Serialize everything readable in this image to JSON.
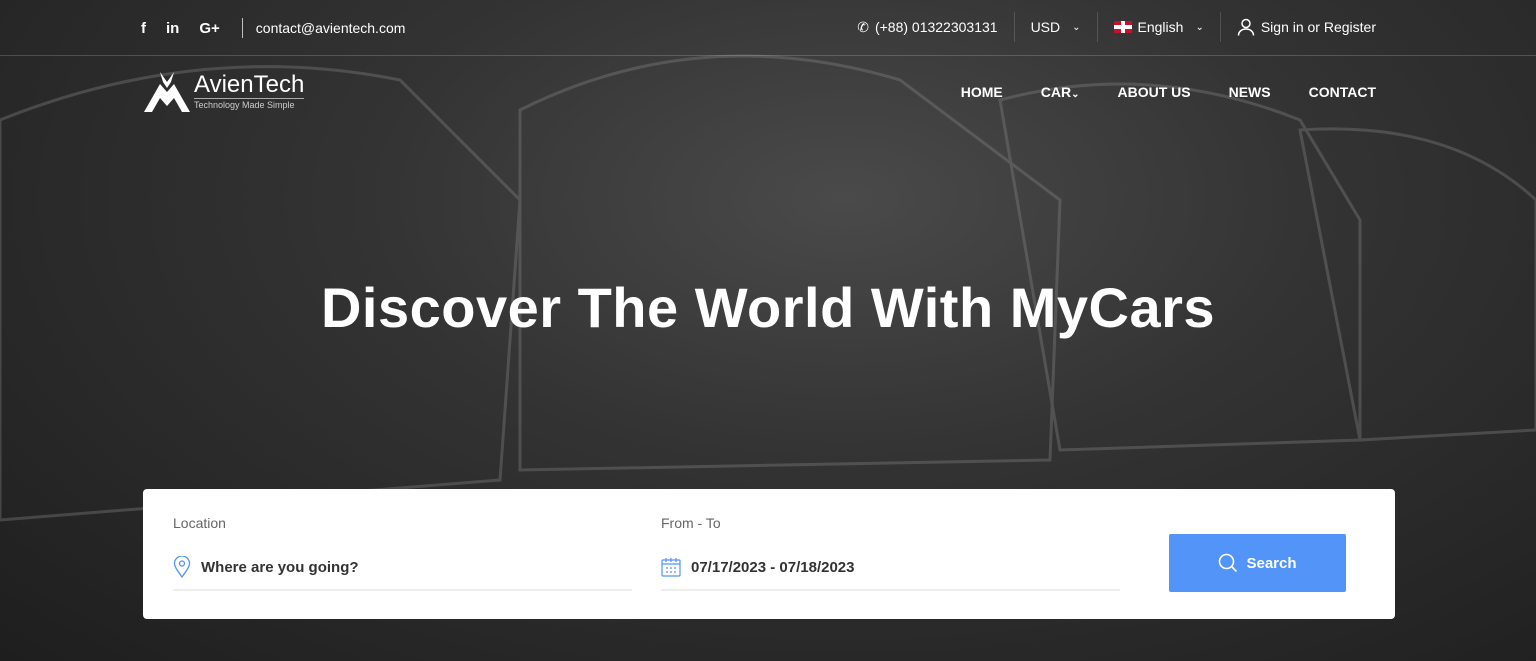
{
  "topbar": {
    "social": [
      "f",
      "in",
      "G+"
    ],
    "email": "contact@avientech.com",
    "phone": "(+88) 01322303131",
    "currency": "USD",
    "language": "English",
    "signin": "Sign in or Register"
  },
  "logo": {
    "name": "AvienTech",
    "tagline": "Technology Made Simple"
  },
  "nav": [
    "HOME",
    "CAR",
    "ABOUT US",
    "NEWS",
    "CONTACT"
  ],
  "hero": {
    "title": "Discover The World With MyCars"
  },
  "search": {
    "location_label": "Location",
    "location_placeholder": "Where are you going?",
    "dates_label": "From - To",
    "dates_value": "07/17/2023 - 07/18/2023",
    "button": "Search",
    "accent": "#5294f7"
  }
}
